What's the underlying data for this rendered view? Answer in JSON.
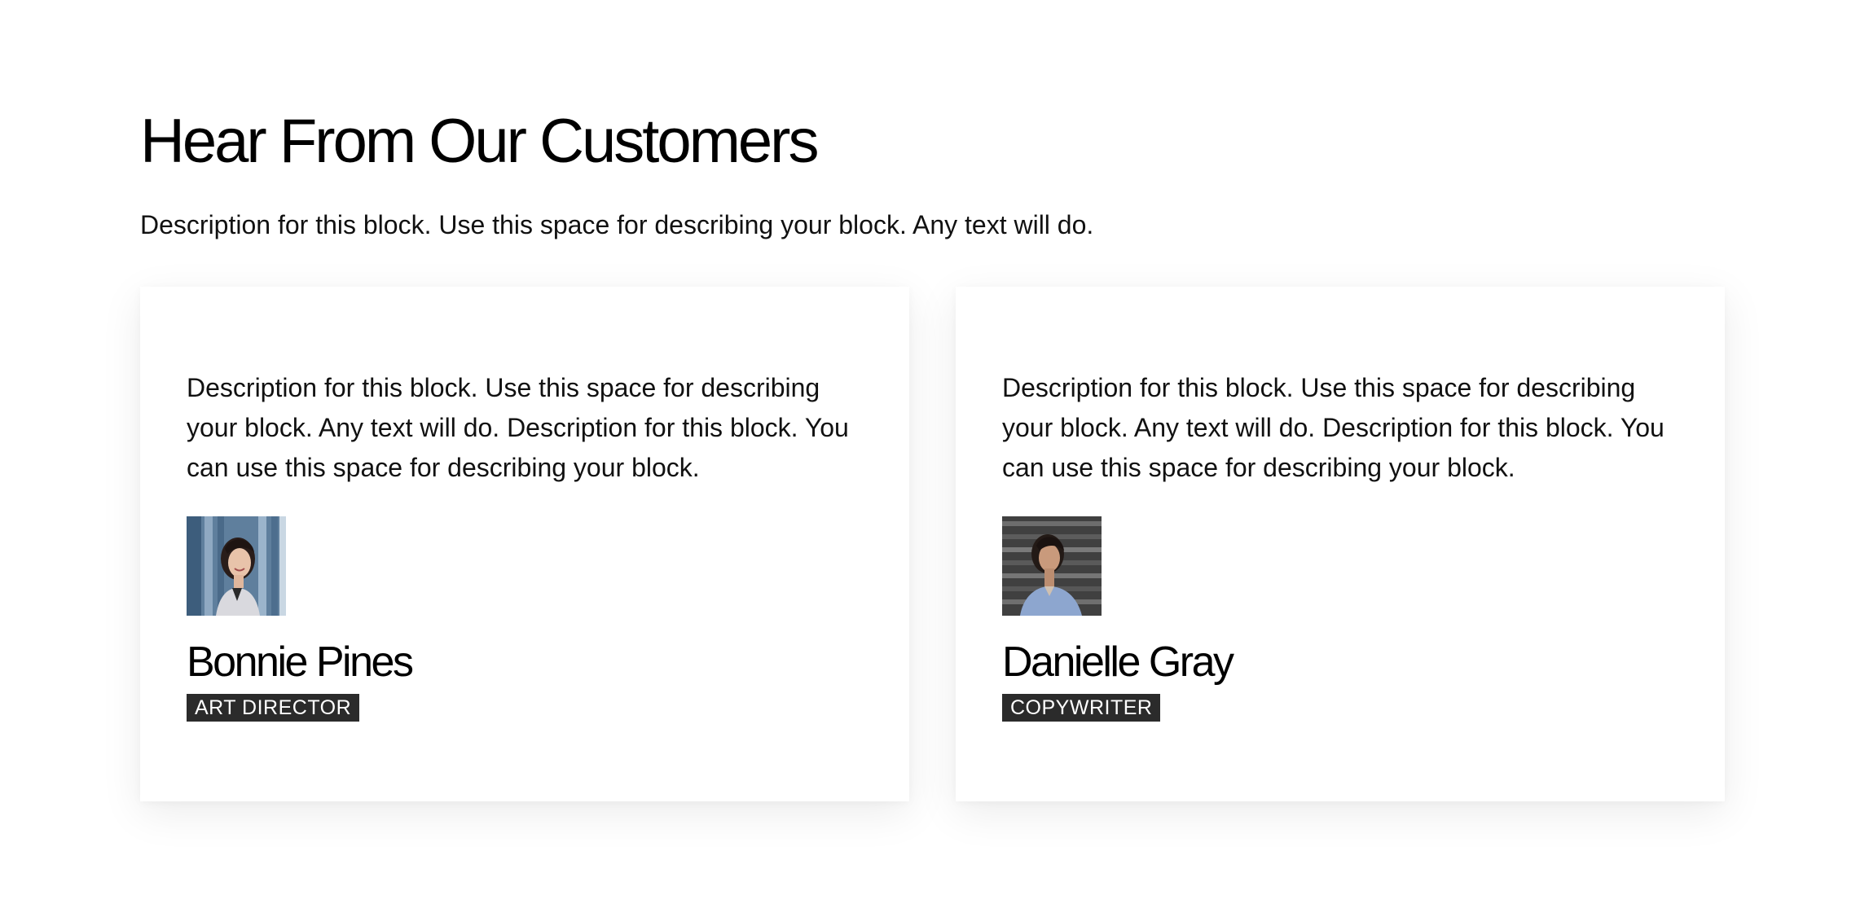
{
  "section": {
    "title": "Hear From Our Customers",
    "description": "Description for this block. Use this space for describing your block. Any text will do."
  },
  "testimonials": [
    {
      "quote": "Description for this block. Use this space for describing your block. Any text will do. Description for this block. You can use this space for describing your block.",
      "name": "Bonnie Pines",
      "role": "ART DIRECTOR",
      "avatar_icon": "person-photo-icon"
    },
    {
      "quote": "Description for this block. Use this space for describing your block. Any text will do. Description for this block. You can use this space for describing your block.",
      "name": "Danielle Gray",
      "role": "COPYWRITER",
      "avatar_icon": "person-photo-icon"
    }
  ],
  "colors": {
    "background": "#ffffff",
    "text": "#111111",
    "role_badge_bg": "#2b2b2b",
    "role_badge_text": "#ffffff"
  }
}
